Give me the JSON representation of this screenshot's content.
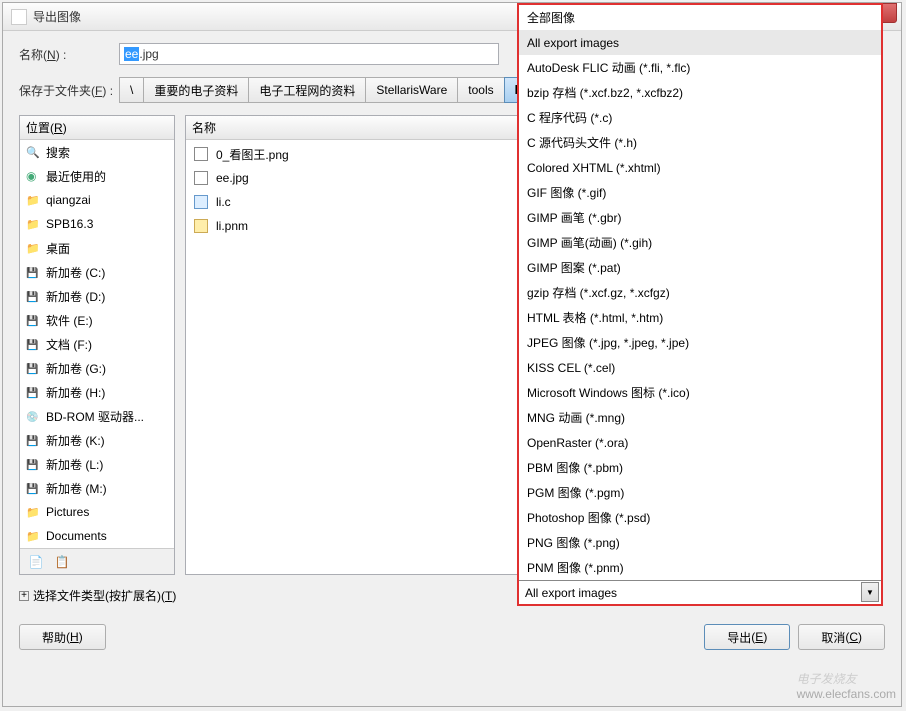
{
  "dialog": {
    "title": "导出图像"
  },
  "name": {
    "label": "名称",
    "label_key": "N",
    "selected": "ee",
    "rest": ".jpg"
  },
  "save_in": {
    "label": "保存于文件夹",
    "label_key": "F",
    "segments": [
      "\\",
      "重要的电子资料",
      "电子工程网的资料",
      "StellarisWare",
      "tools",
      "bin"
    ]
  },
  "places": {
    "header": "位置",
    "header_key": "R",
    "items": [
      {
        "icon": "search",
        "label": "搜索"
      },
      {
        "icon": "recent",
        "label": "最近使用的"
      },
      {
        "icon": "folder",
        "label": "qiangzai"
      },
      {
        "icon": "folder",
        "label": "SPB16.3"
      },
      {
        "icon": "folder",
        "label": "桌面"
      },
      {
        "icon": "drive",
        "label": "新加卷 (C:)"
      },
      {
        "icon": "drive",
        "label": "新加卷 (D:)"
      },
      {
        "icon": "drive",
        "label": "软件 (E:)"
      },
      {
        "icon": "drive",
        "label": "文档 (F:)"
      },
      {
        "icon": "drive",
        "label": "新加卷 (G:)"
      },
      {
        "icon": "drive",
        "label": "新加卷 (H:)"
      },
      {
        "icon": "bd",
        "label": "BD-ROM 驱动器..."
      },
      {
        "icon": "drive",
        "label": "新加卷 (K:)"
      },
      {
        "icon": "drive",
        "label": "新加卷 (L:)"
      },
      {
        "icon": "drive",
        "label": "新加卷 (M:)"
      },
      {
        "icon": "folder",
        "label": "Pictures"
      },
      {
        "icon": "folder",
        "label": "Documents"
      }
    ]
  },
  "files": {
    "header": "名称",
    "items": [
      {
        "icon": "png",
        "label": "0_看图王.png"
      },
      {
        "icon": "jpg",
        "label": "ee.jpg"
      },
      {
        "icon": "c",
        "label": "li.c"
      },
      {
        "icon": "pnm",
        "label": "li.pnm"
      }
    ]
  },
  "filetype": {
    "expander": "选择文件类型(按扩展名)",
    "expander_key": "T"
  },
  "buttons": {
    "help": "帮助",
    "help_key": "H",
    "export": "导出",
    "export_key": "E",
    "cancel": "取消",
    "cancel_key": "C"
  },
  "dropdown": {
    "items": [
      "全部图像",
      "All export images",
      "AutoDesk FLIC 动画 (*.fli, *.flc)",
      "bzip 存档 (*.xcf.bz2, *.xcfbz2)",
      "C 程序代码 (*.c)",
      "C 源代码头文件 (*.h)",
      "Colored XHTML (*.xhtml)",
      "GIF 图像 (*.gif)",
      "GIMP 画笔 (*.gbr)",
      "GIMP 画笔(动画) (*.gih)",
      "GIMP 图案 (*.pat)",
      "gzip 存档 (*.xcf.gz, *.xcfgz)",
      "HTML 表格 (*.html, *.htm)",
      "JPEG 图像 (*.jpg, *.jpeg, *.jpe)",
      "KISS CEL (*.cel)",
      "Microsoft Windows 图标 (*.ico)",
      "MNG 动画 (*.mng)",
      "OpenRaster (*.ora)",
      "PBM 图像 (*.pbm)",
      "PGM 图像 (*.pgm)",
      "Photoshop 图像 (*.psd)",
      "PNG 图像 (*.png)",
      "PNM 图像 (*.pnm)"
    ],
    "selected": "All export images",
    "highlighted_index": 1
  },
  "watermark": {
    "text": "www.elecfans.com",
    "brand": "电子发烧友"
  }
}
